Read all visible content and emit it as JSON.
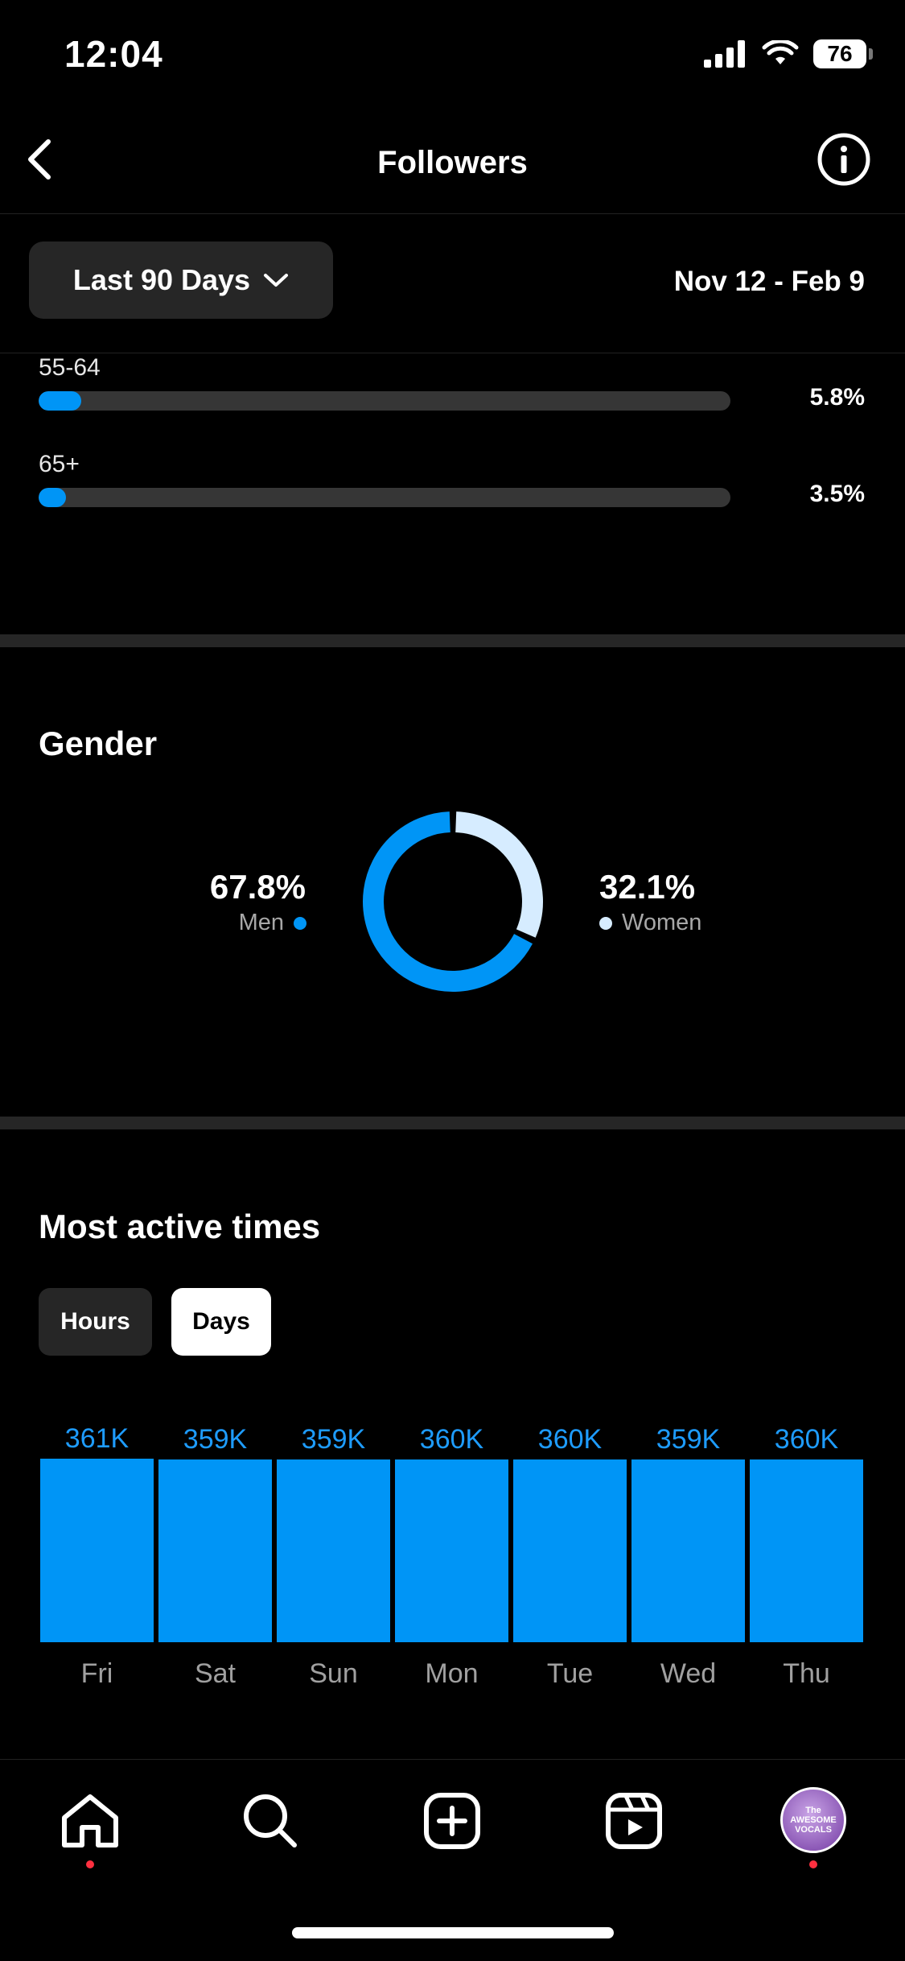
{
  "status_bar": {
    "time": "12:04",
    "battery": "76"
  },
  "header": {
    "title": "Followers"
  },
  "filter": {
    "range_label": "Last 90 Days",
    "date_range": "Nov 12 - Feb 9"
  },
  "age": {
    "items": [
      {
        "label": "55-64",
        "percent": "5.8%",
        "value": 5.8
      },
      {
        "label": "65+",
        "percent": "3.5%",
        "value": 3.5
      }
    ]
  },
  "gender": {
    "title": "Gender",
    "men": {
      "percent": "67.8%",
      "label": "Men",
      "color": "#0095f6"
    },
    "women": {
      "percent": "32.1%",
      "label": "Women",
      "color": "#d6ecff"
    }
  },
  "active_times": {
    "title": "Most active times",
    "toggle": {
      "hours": "Hours",
      "days": "Days",
      "selected": "Days"
    }
  },
  "chart_data": {
    "type": "bar",
    "categories": [
      "Fri",
      "Sat",
      "Sun",
      "Mon",
      "Tue",
      "Wed",
      "Thu"
    ],
    "values": [
      361,
      359,
      359,
      360,
      360,
      359,
      360
    ],
    "value_labels": [
      "361K",
      "359K",
      "359K",
      "360K",
      "360K",
      "359K",
      "360K"
    ],
    "color": "#0095f6"
  },
  "tab_bar": {
    "icons": [
      "home-icon",
      "search-icon",
      "create-icon",
      "reels-icon",
      "profile-avatar"
    ],
    "avatar_text": "The AWESOME VOCALS"
  }
}
